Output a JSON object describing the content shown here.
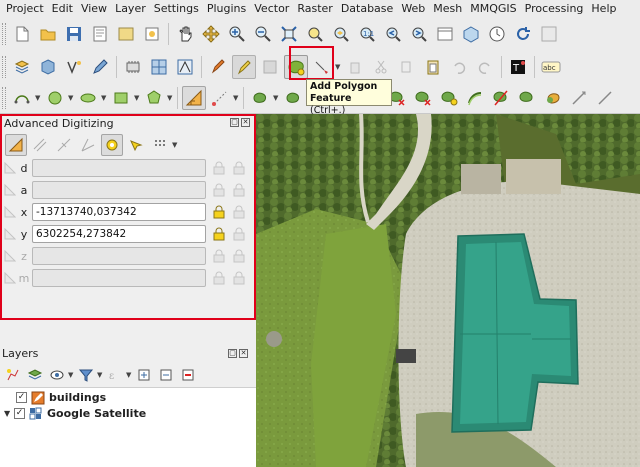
{
  "menu": {
    "items": [
      "Project",
      "Edit",
      "View",
      "Layer",
      "Settings",
      "Plugins",
      "Vector",
      "Raster",
      "Database",
      "Web",
      "Mesh",
      "MMQGIS",
      "Processing",
      "Help"
    ]
  },
  "tooltip": {
    "title": "Add Polygon",
    "line2": "Feature",
    "shortcut": "(Ctrl+.)"
  },
  "advanced_digitizing": {
    "title": "Advanced Digitizing",
    "rows": [
      {
        "label": "d",
        "value": ""
      },
      {
        "label": "a",
        "value": ""
      },
      {
        "label": "x",
        "value": "-13713740,037342"
      },
      {
        "label": "y",
        "value": "6302254,273842"
      },
      {
        "label": "z",
        "value": ""
      },
      {
        "label": "m",
        "value": ""
      }
    ]
  },
  "layers": {
    "title": "Layers",
    "items": [
      {
        "name": "buildings",
        "checked": true
      },
      {
        "name": "Google Satellite",
        "checked": true
      }
    ]
  },
  "colors": {
    "highlight": "#e0001a",
    "tooltip_bg": "#fffedc",
    "roof": "#2e9a80",
    "polygon_icon": "#7fb23a"
  }
}
